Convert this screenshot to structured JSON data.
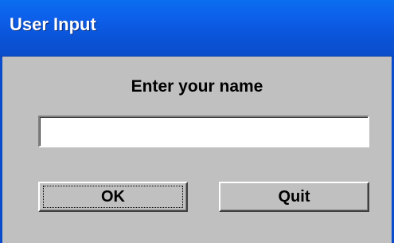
{
  "window": {
    "title": "User Input"
  },
  "dialog": {
    "prompt": "Enter your name",
    "name_value": "",
    "ok_label": "OK",
    "quit_label": "Quit"
  },
  "colors": {
    "titlebar": "#0a5ee8",
    "face": "#c0c0c0",
    "title_text": "#ffffff"
  }
}
